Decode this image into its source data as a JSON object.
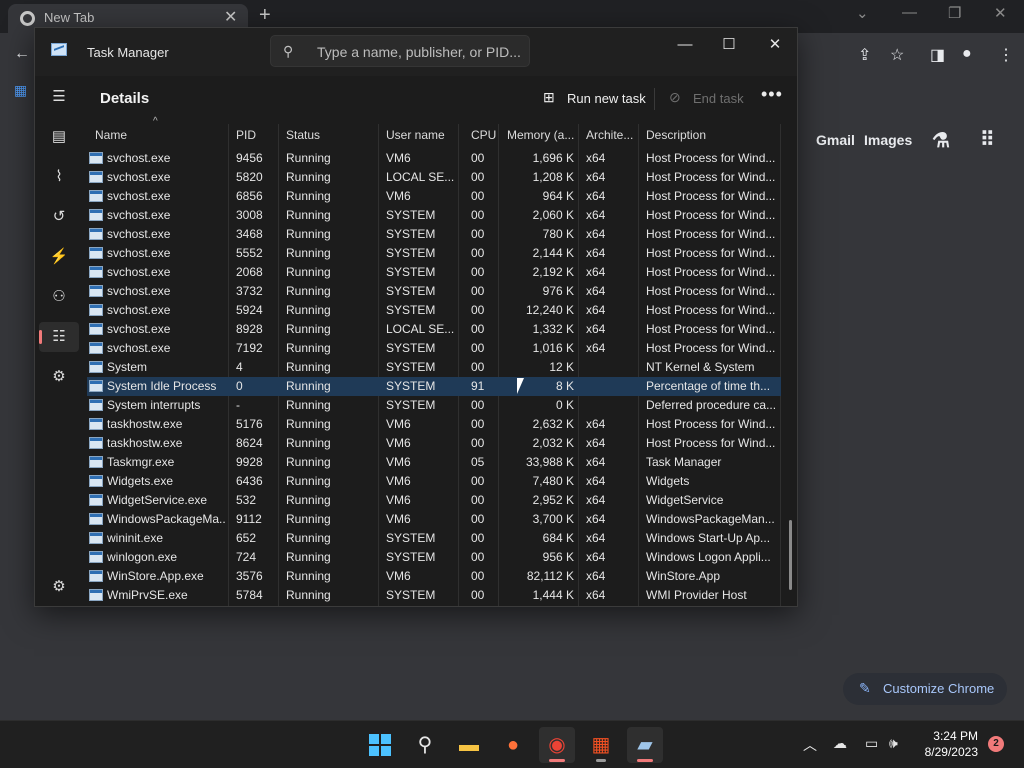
{
  "chrome": {
    "tab_title": "New Tab",
    "ntp_links": [
      "Gmail",
      "Images"
    ],
    "customize_label": "Customize Chrome"
  },
  "task_manager": {
    "window_title": "Task Manager",
    "search_placeholder": "Type a name, publisher, or PID...",
    "page_title": "Details",
    "run_new_task": "Run new task",
    "end_task": "End task",
    "columns": [
      "Name",
      "PID",
      "Status",
      "User name",
      "CPU",
      "Memory (a...",
      "Archite...",
      "Description"
    ],
    "rows": [
      {
        "name": "svchost.exe",
        "pid": "9456",
        "status": "Running",
        "user": "VM6",
        "cpu": "00",
        "memory": "1,696 K",
        "arch": "x64",
        "desc": "Host Process for Wind..."
      },
      {
        "name": "svchost.exe",
        "pid": "5820",
        "status": "Running",
        "user": "LOCAL SE...",
        "cpu": "00",
        "memory": "1,208 K",
        "arch": "x64",
        "desc": "Host Process for Wind..."
      },
      {
        "name": "svchost.exe",
        "pid": "6856",
        "status": "Running",
        "user": "VM6",
        "cpu": "00",
        "memory": "964 K",
        "arch": "x64",
        "desc": "Host Process for Wind..."
      },
      {
        "name": "svchost.exe",
        "pid": "3008",
        "status": "Running",
        "user": "SYSTEM",
        "cpu": "00",
        "memory": "2,060 K",
        "arch": "x64",
        "desc": "Host Process for Wind..."
      },
      {
        "name": "svchost.exe",
        "pid": "3468",
        "status": "Running",
        "user": "SYSTEM",
        "cpu": "00",
        "memory": "780 K",
        "arch": "x64",
        "desc": "Host Process for Wind..."
      },
      {
        "name": "svchost.exe",
        "pid": "5552",
        "status": "Running",
        "user": "SYSTEM",
        "cpu": "00",
        "memory": "2,144 K",
        "arch": "x64",
        "desc": "Host Process for Wind..."
      },
      {
        "name": "svchost.exe",
        "pid": "2068",
        "status": "Running",
        "user": "SYSTEM",
        "cpu": "00",
        "memory": "2,192 K",
        "arch": "x64",
        "desc": "Host Process for Wind..."
      },
      {
        "name": "svchost.exe",
        "pid": "3732",
        "status": "Running",
        "user": "SYSTEM",
        "cpu": "00",
        "memory": "976 K",
        "arch": "x64",
        "desc": "Host Process for Wind..."
      },
      {
        "name": "svchost.exe",
        "pid": "5924",
        "status": "Running",
        "user": "SYSTEM",
        "cpu": "00",
        "memory": "12,240 K",
        "arch": "x64",
        "desc": "Host Process for Wind..."
      },
      {
        "name": "svchost.exe",
        "pid": "8928",
        "status": "Running",
        "user": "LOCAL SE...",
        "cpu": "00",
        "memory": "1,332 K",
        "arch": "x64",
        "desc": "Host Process for Wind..."
      },
      {
        "name": "svchost.exe",
        "pid": "7192",
        "status": "Running",
        "user": "SYSTEM",
        "cpu": "00",
        "memory": "1,016 K",
        "arch": "x64",
        "desc": "Host Process for Wind..."
      },
      {
        "name": "System",
        "pid": "4",
        "status": "Running",
        "user": "SYSTEM",
        "cpu": "00",
        "memory": "12 K",
        "arch": "",
        "desc": "NT Kernel & System"
      },
      {
        "name": "System Idle Process",
        "pid": "0",
        "status": "Running",
        "user": "SYSTEM",
        "cpu": "91",
        "memory": "8 K",
        "arch": "",
        "desc": "Percentage of time th...",
        "selected": true
      },
      {
        "name": "System interrupts",
        "pid": "-",
        "status": "Running",
        "user": "SYSTEM",
        "cpu": "00",
        "memory": "0 K",
        "arch": "",
        "desc": "Deferred procedure ca..."
      },
      {
        "name": "taskhostw.exe",
        "pid": "5176",
        "status": "Running",
        "user": "VM6",
        "cpu": "00",
        "memory": "2,632 K",
        "arch": "x64",
        "desc": "Host Process for Wind..."
      },
      {
        "name": "taskhostw.exe",
        "pid": "8624",
        "status": "Running",
        "user": "VM6",
        "cpu": "00",
        "memory": "2,032 K",
        "arch": "x64",
        "desc": "Host Process for Wind..."
      },
      {
        "name": "Taskmgr.exe",
        "pid": "9928",
        "status": "Running",
        "user": "VM6",
        "cpu": "05",
        "memory": "33,988 K",
        "arch": "x64",
        "desc": "Task Manager"
      },
      {
        "name": "Widgets.exe",
        "pid": "6436",
        "status": "Running",
        "user": "VM6",
        "cpu": "00",
        "memory": "7,480 K",
        "arch": "x64",
        "desc": "Widgets"
      },
      {
        "name": "WidgetService.exe",
        "pid": "532",
        "status": "Running",
        "user": "VM6",
        "cpu": "00",
        "memory": "2,952 K",
        "arch": "x64",
        "desc": "WidgetService"
      },
      {
        "name": "WindowsPackageMa...",
        "pid": "9112",
        "status": "Running",
        "user": "VM6",
        "cpu": "00",
        "memory": "3,700 K",
        "arch": "x64",
        "desc": "WindowsPackageMan..."
      },
      {
        "name": "wininit.exe",
        "pid": "652",
        "status": "Running",
        "user": "SYSTEM",
        "cpu": "00",
        "memory": "684 K",
        "arch": "x64",
        "desc": "Windows Start-Up Ap..."
      },
      {
        "name": "winlogon.exe",
        "pid": "724",
        "status": "Running",
        "user": "SYSTEM",
        "cpu": "00",
        "memory": "956 K",
        "arch": "x64",
        "desc": "Windows Logon Appli..."
      },
      {
        "name": "WinStore.App.exe",
        "pid": "3576",
        "status": "Running",
        "user": "VM6",
        "cpu": "00",
        "memory": "82,112 K",
        "arch": "x64",
        "desc": "WinStore.App"
      },
      {
        "name": "WmiPrvSE.exe",
        "pid": "5784",
        "status": "Running",
        "user": "SYSTEM",
        "cpu": "00",
        "memory": "1,444 K",
        "arch": "x64",
        "desc": "WMI Provider Host"
      }
    ]
  },
  "taskbar": {
    "time": "3:24 PM",
    "date": "8/29/2023",
    "notification_count": "2"
  }
}
